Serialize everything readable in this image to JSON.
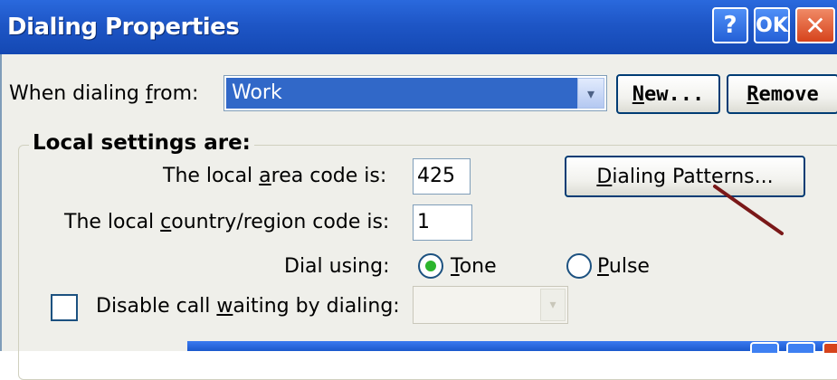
{
  "window": {
    "title": "Dialing Properties",
    "help_label": "?",
    "ok_label": "OK",
    "close_label": "✕"
  },
  "dialing_from": {
    "label_pre": "When dialing ",
    "label_key": "f",
    "label_post": "rom:",
    "value": "Work",
    "arrow": "▾",
    "new_pre": "",
    "new_key": "N",
    "new_post": "ew...",
    "remove_pre": "",
    "remove_key": "R",
    "remove_post": "emove"
  },
  "local_settings": {
    "title": "Local settings are:",
    "area_label_pre": "The local ",
    "area_label_key": "a",
    "area_label_post": "rea code is:",
    "area_value": "425",
    "country_label_pre": "The local ",
    "country_label_key": "c",
    "country_label_post": "ountry/region code is:",
    "country_value": "1",
    "patterns_pre": "",
    "patterns_key": "D",
    "patterns_post": "ialing Patterns...",
    "dial_label": "Dial using:",
    "tone_key": "T",
    "tone_post": "one",
    "pulse_key": "P",
    "pulse_post": "ulse",
    "tone_selected": true,
    "callwait_pre": "Disable call ",
    "callwait_key": "w",
    "callwait_post": "aiting by dialing:",
    "callwait_checked": false,
    "callwait_arrow": "▾"
  },
  "colors": {
    "titlebar": "#1e56c6",
    "selection": "#3168c8",
    "dialog_bg": "#efefea",
    "annotation_arrow": "#7a1818"
  }
}
